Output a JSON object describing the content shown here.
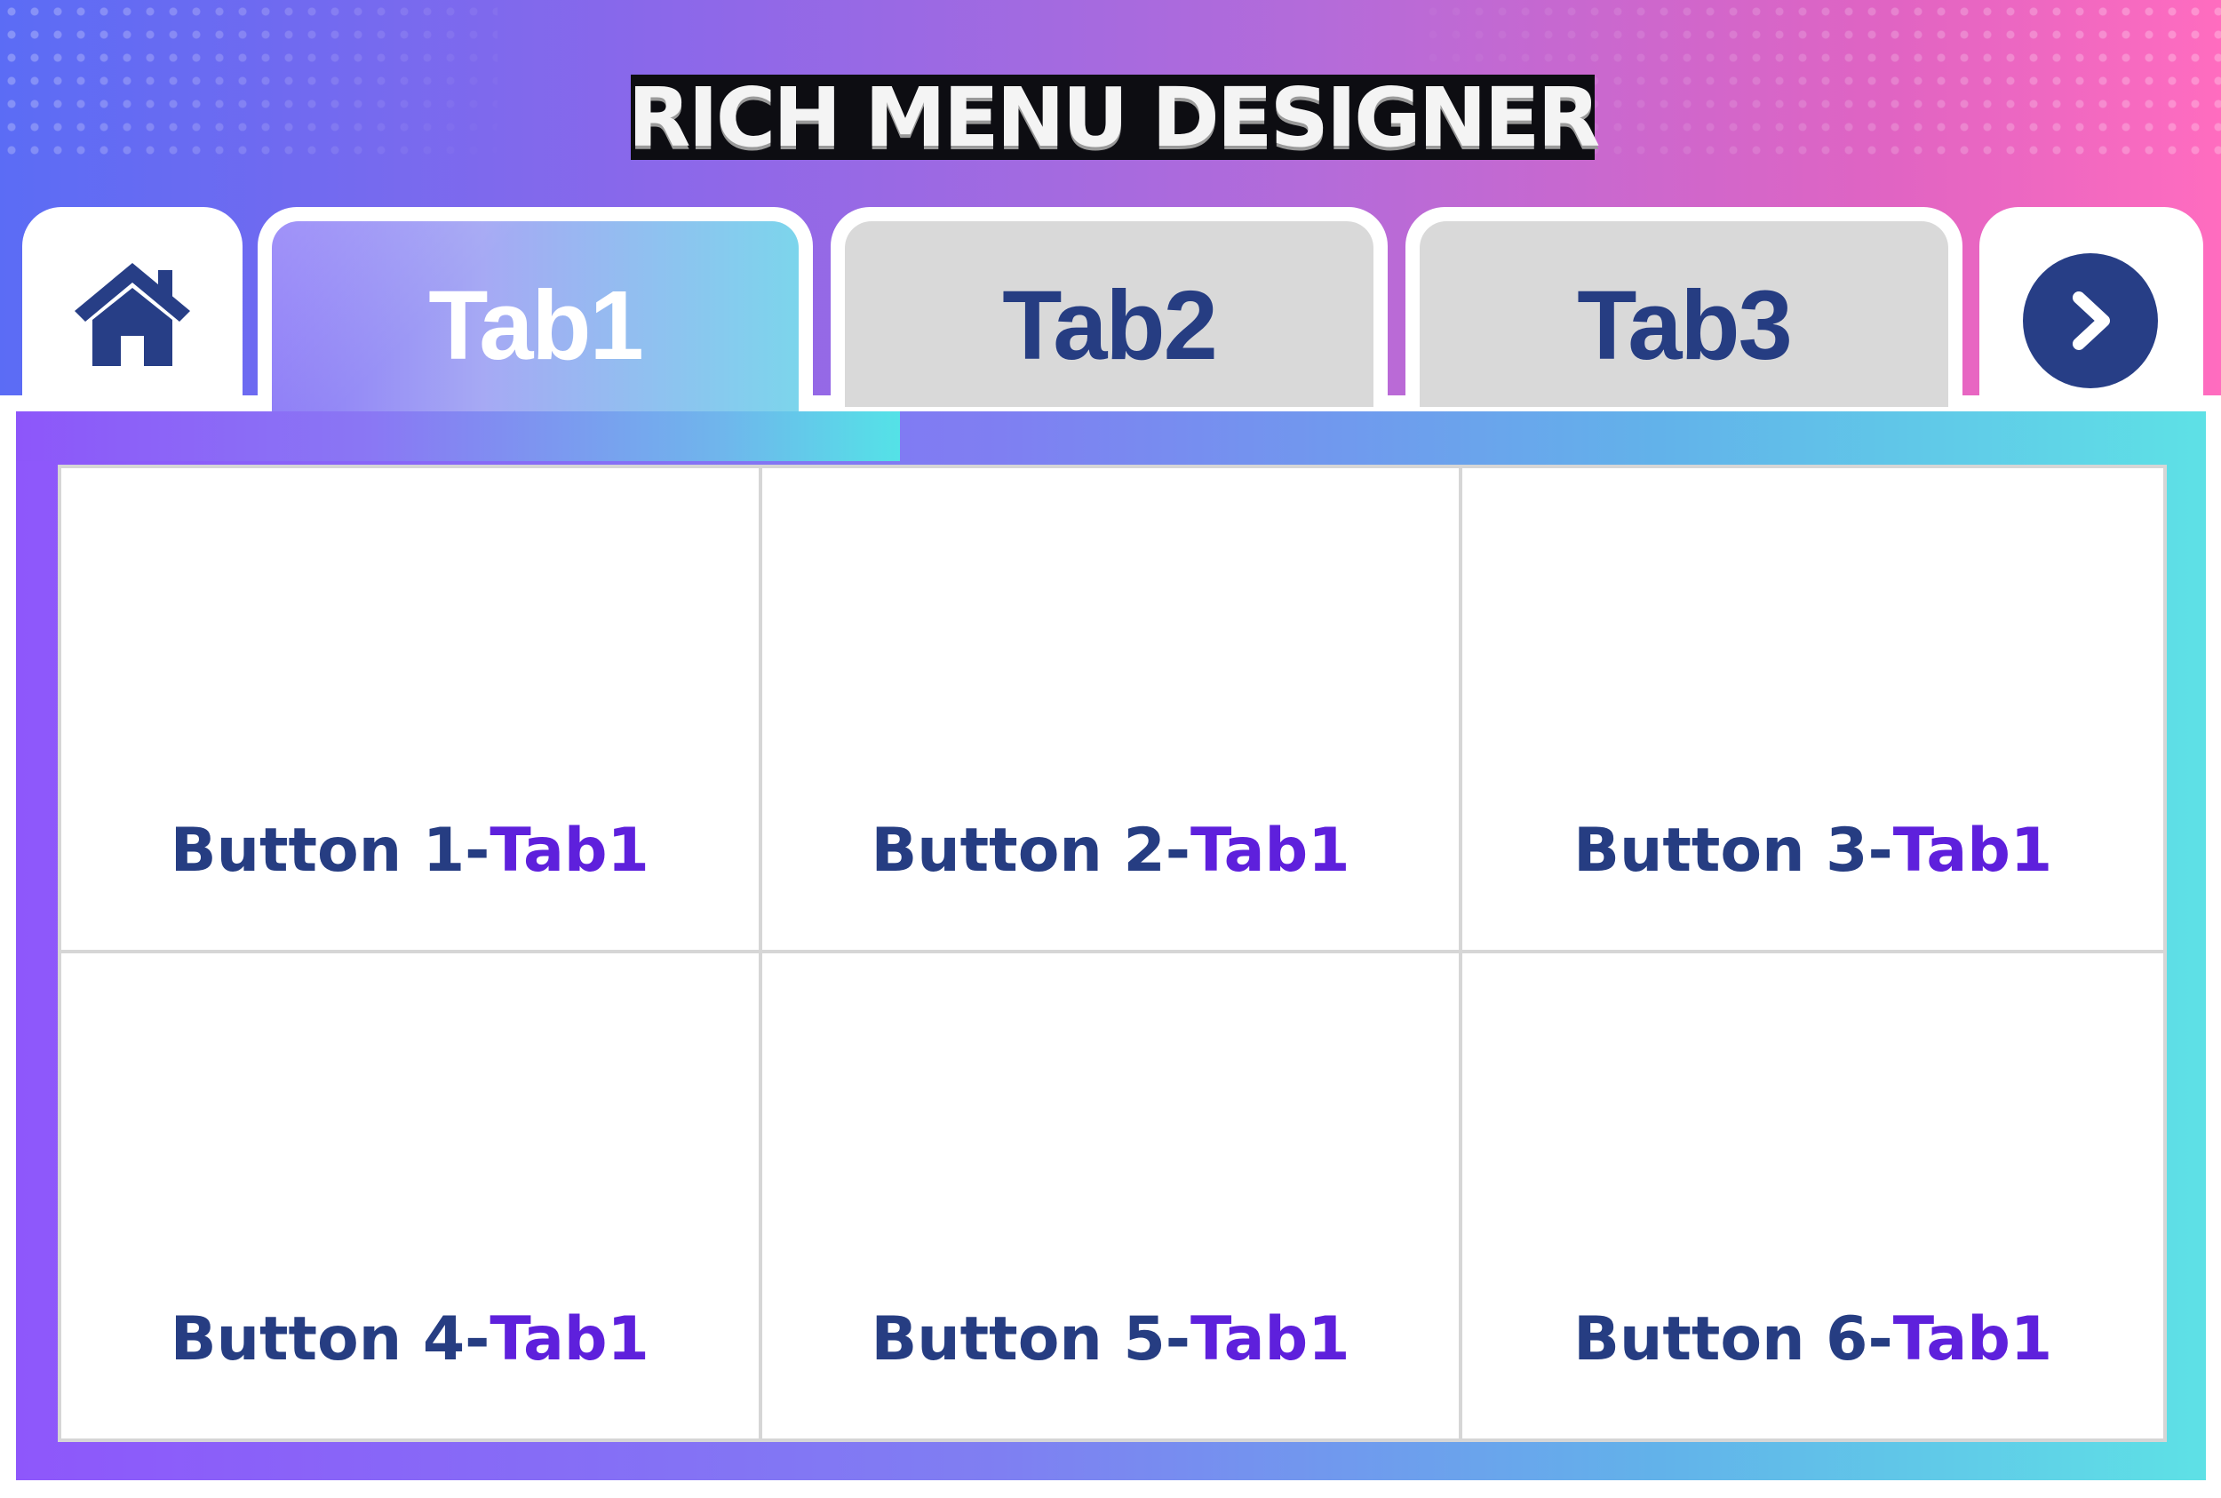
{
  "header": {
    "title": "RICH MENU DESIGNER"
  },
  "tabs": [
    {
      "label": "Tab1",
      "active": true
    },
    {
      "label": "Tab2",
      "active": false
    },
    {
      "label": "Tab3",
      "active": false
    }
  ],
  "nav": {
    "home_icon": "home-icon",
    "next_icon": "chevron-right-icon"
  },
  "buttons": [
    {
      "label": "Button 1-",
      "tab": "Tab1"
    },
    {
      "label": "Button 2-",
      "tab": "Tab1"
    },
    {
      "label": "Button 3-",
      "tab": "Tab1"
    },
    {
      "label": "Button 4-",
      "tab": "Tab1"
    },
    {
      "label": "Button 5-",
      "tab": "Tab1"
    },
    {
      "label": "Button 6-",
      "tab": "Tab1"
    }
  ],
  "colors": {
    "navy": "#263d82",
    "accent_purple": "#5e20dc",
    "inactive_tab": "#d9d9d9",
    "grid_line": "#d6d6d6"
  }
}
